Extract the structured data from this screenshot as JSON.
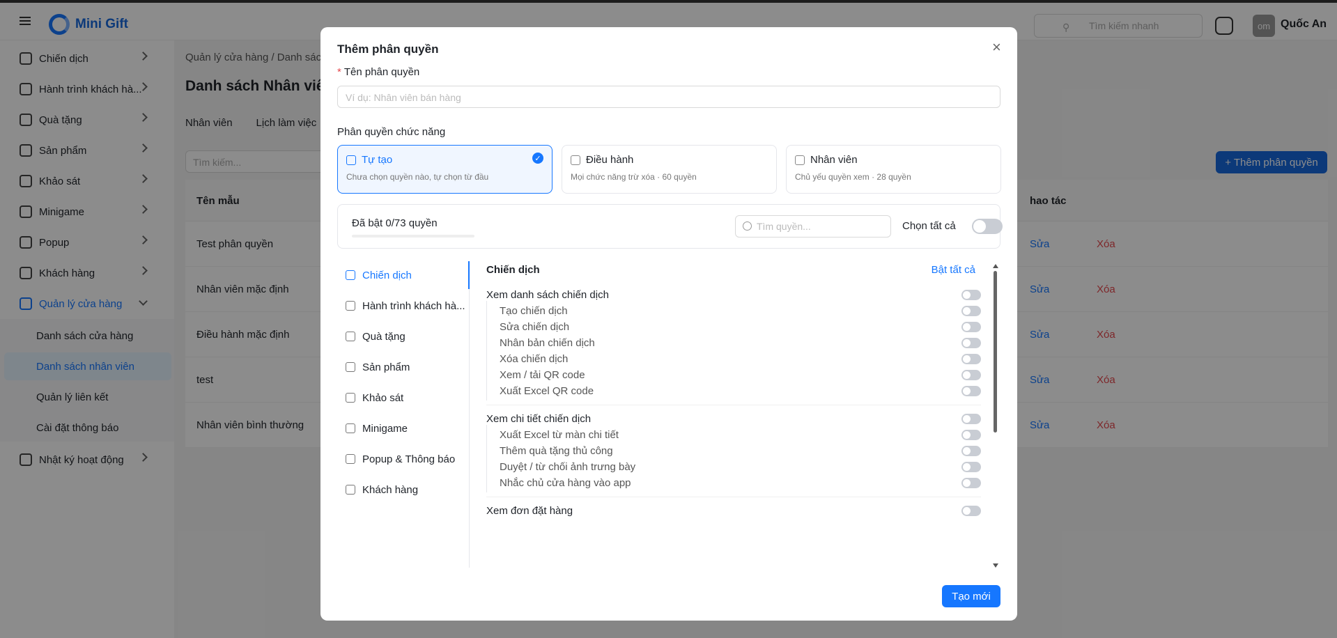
{
  "header": {
    "brand": "Mini Gift",
    "search_placeholder": "Tìm kiếm nhanh",
    "avatar_initials": "om",
    "username": "Quốc An"
  },
  "sidebar": {
    "items": [
      {
        "label": "Chiến dịch"
      },
      {
        "label": "Hành trình khách hà..."
      },
      {
        "label": "Quà tặng"
      },
      {
        "label": "Sản phẩm"
      },
      {
        "label": "Khảo sát"
      },
      {
        "label": "Minigame"
      },
      {
        "label": "Popup"
      },
      {
        "label": "Khách hàng"
      },
      {
        "label": "Quản lý cửa hàng"
      },
      {
        "label": "Nhật ký hoạt động"
      }
    ],
    "sub_items": [
      {
        "label": "Danh sách cửa hàng"
      },
      {
        "label": "Danh sách nhân viên"
      },
      {
        "label": "Quản lý liên kết"
      },
      {
        "label": "Cài đặt thông báo"
      }
    ]
  },
  "content": {
    "breadcrumb": "Quản lý cửa hàng  /  Danh sác",
    "title": "Danh sách Nhân viên",
    "tabs": [
      "Nhân viên",
      "Lịch làm việc"
    ],
    "search_placeholder": "Tìm kiếm...",
    "add_button": "+ Thêm phân quyền",
    "table": {
      "col_name": "Tên mẫu",
      "col_actions": "hao tác",
      "edit_label": "Sửa",
      "delete_label": "Xóa",
      "rows": [
        "Test phân quyền",
        "Nhân viên mặc định",
        "Điều hành mặc định",
        "test",
        "Nhân viên bình thường"
      ]
    }
  },
  "modal": {
    "title": "Thêm phân quyền",
    "name_label": "Tên phân quyền",
    "name_placeholder": "Ví dụ: Nhân viên bán hàng",
    "func_label": "Phân quyền chức năng",
    "cards": [
      {
        "title": "Tự tạo",
        "sub": "Chưa chọn quyền nào, tự chọn từ đầu"
      },
      {
        "title": "Điều hành",
        "sub": "Mọi chức năng trừ xóa · 60 quyền"
      },
      {
        "title": "Nhân viên",
        "sub": "Chủ yếu quyền xem · 28 quyền"
      }
    ],
    "enabled_count": "Đã bật 0/73 quyền",
    "enabled_fraction": 0,
    "perm_search_placeholder": "Tìm quyền...",
    "select_all": "Chọn tất cả",
    "categories": [
      "Chiến dịch",
      "Hành trình khách hà...",
      "Quà tặng",
      "Sản phẩm",
      "Khảo sát",
      "Minigame",
      "Popup & Thông báo",
      "Khách hàng"
    ],
    "panel_title": "Chiến dịch",
    "enable_all": "Bật tất cả",
    "groups": [
      {
        "label": "Xem danh sách chiến dịch",
        "children": [
          "Tạo chiến dịch",
          "Sửa chiến dịch",
          "Nhân bản chiến dịch",
          "Xóa chiến dịch",
          "Xem / tải QR code",
          "Xuất Excel QR code"
        ]
      },
      {
        "label": "Xem chi tiết chiến dịch",
        "children": [
          "Xuất Excel từ màn chi tiết",
          "Thêm quà tặng thủ công",
          "Duyệt / từ chối ảnh trưng bày",
          "Nhắc chủ cửa hàng vào app"
        ]
      },
      {
        "label": "Xem đơn đặt hàng",
        "children": []
      }
    ],
    "create_button": "Tạo mới",
    "colors": {
      "primary": "#1677ff",
      "danger": "#e5484d"
    }
  }
}
